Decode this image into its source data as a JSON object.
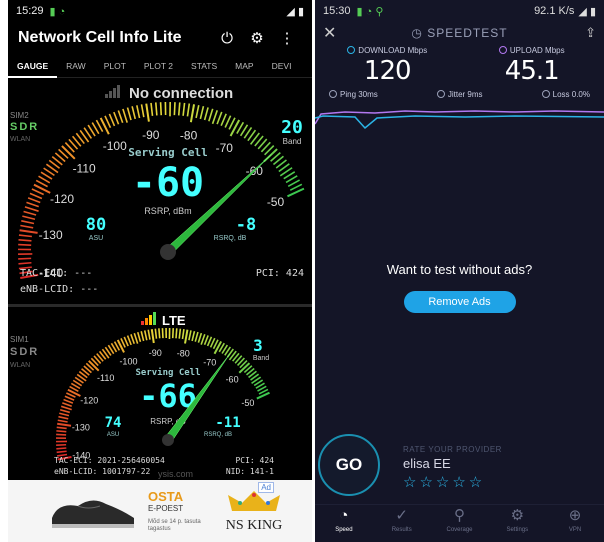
{
  "left": {
    "status": {
      "time": "15:29",
      "icons": "▮◢▮"
    },
    "app_title": "Network Cell Info Lite",
    "tabs": [
      "GAUGE",
      "RAW",
      "PLOT",
      "PLOT 2",
      "STATS",
      "MAP",
      "DEVI"
    ],
    "sim2": {
      "no_connection": "No connection",
      "sim_label": "SIM2",
      "sdr": "SDR",
      "wlan": "WLAN",
      "scale": [
        "-140",
        "-130",
        "-120",
        "-110",
        "-100",
        "-90",
        "-80",
        "-70",
        "-60",
        "-50"
      ],
      "serving_cell": "Serving Cell",
      "rsrp_value": "-60",
      "rsrp_label": "RSRP, dBm",
      "asu_value": "80",
      "asu_label": "ASU",
      "rsrq_value": "-8",
      "rsrq_label": "RSRQ, dB",
      "band_value": "20",
      "band_label": "Band",
      "tac_eci": "TAC-ECI: ---",
      "enb_lcid": "eNB-LCID: ---",
      "pci": "PCI: 424",
      "needle": -60
    },
    "sim1": {
      "network": "LTE",
      "sim_label": "SIM1",
      "sdr": "SDR",
      "wlan": "WLAN",
      "scale": [
        "-140",
        "-130",
        "-120",
        "-110",
        "-100",
        "-90",
        "-80",
        "-70",
        "-60",
        "-50"
      ],
      "serving_cell": "Serving Cell",
      "rsrp_value": "-66",
      "rsrp_label": "RSRP, dB",
      "asu_value": "74",
      "asu_label": "ASU",
      "rsrq_value": "-11",
      "rsrq_label": "RSRQ, dB",
      "band_value": "3",
      "band_label": "Band",
      "tac_eci": "TAC-ECI: 2021-256460054",
      "enb_lcid": "eNB-LCID: 1001797-22",
      "pci": "PCI: 424",
      "nid": "NID: 141-1",
      "watermark": "ysis.com",
      "needle": -66
    },
    "ad": {
      "brand": "OSTA",
      "sub": "E-POEST",
      "small": "Mõd se 14 p. tasuta tagastus",
      "king": "NS KING",
      "tag": "Ad"
    }
  },
  "right": {
    "status": {
      "time": "15:30",
      "rate": "92.1 K/s"
    },
    "brand": "SPEEDTEST",
    "download_label": "DOWNLOAD Mbps",
    "upload_label": "UPLOAD Mbps",
    "download_value": "120",
    "upload_value": "45.1",
    "ping": "Ping 30ms",
    "jitter": "Jitter 9ms",
    "loss": "Loss 0.0%",
    "promo_question": "Want to test without ads?",
    "promo_button": "Remove Ads",
    "go": "GO",
    "rate_label": "RATE YOUR PROVIDER",
    "provider": "elisa EE",
    "stars": "☆☆☆☆☆",
    "nav": [
      "Speed",
      "Results",
      "Coverage",
      "Settings",
      "VPN"
    ],
    "colors": {
      "download": "#2bb4e6",
      "upload": "#b278f0",
      "accent": "#1fa3e6"
    }
  }
}
